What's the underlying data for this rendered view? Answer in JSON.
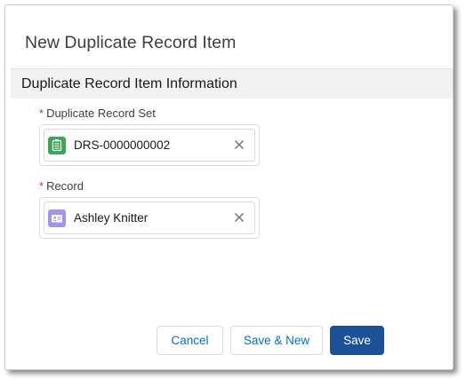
{
  "modal": {
    "title": "New Duplicate Record Item"
  },
  "section": {
    "title": "Duplicate Record Item Information"
  },
  "fields": {
    "duplicate_record_set": {
      "required_marker": "*",
      "label": "Duplicate Record Set",
      "value": "DRS-0000000002",
      "icon": "duplicate-record-set-icon",
      "icon_color": "#3ba755"
    },
    "record": {
      "required_marker": "*",
      "label": "Record",
      "value": "Ashley Knitter",
      "icon": "contact-card-icon",
      "icon_color": "#a094ed"
    }
  },
  "footer": {
    "cancel_label": "Cancel",
    "save_new_label": "Save & New",
    "save_label": "Save"
  },
  "colors": {
    "brand": "#1b5297",
    "link": "#0070d2",
    "required": "#c23934",
    "section_bg": "#f3f2f2"
  }
}
